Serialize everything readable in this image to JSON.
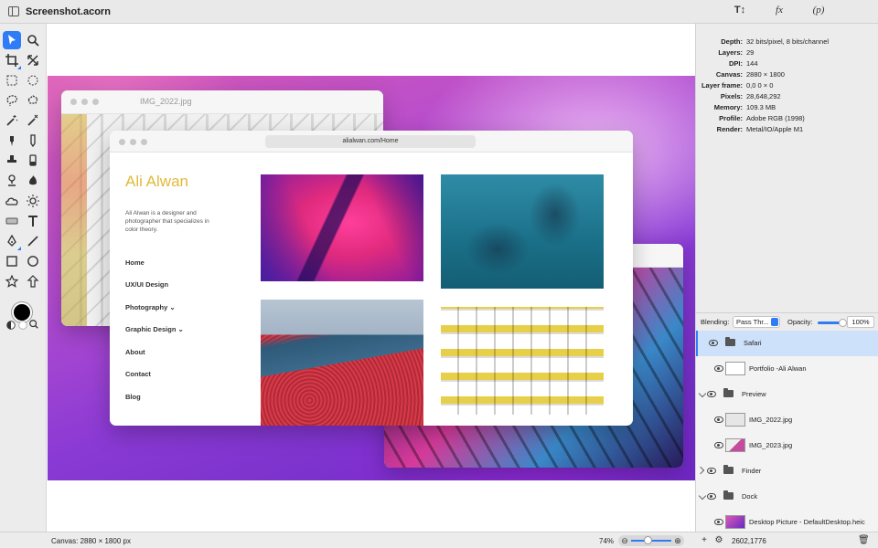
{
  "window": {
    "title": "Screenshot.acorn"
  },
  "titlebar_buttons": {
    "text_tool": "T↕",
    "fx": "fx",
    "p": "(p)"
  },
  "inspector": {
    "rows": [
      {
        "key": "Depth:",
        "value": "32 bits/pixel, 8 bits/channel"
      },
      {
        "key": "Layers:",
        "value": "29"
      },
      {
        "key": "DPI:",
        "value": "144"
      },
      {
        "key": "Canvas:",
        "value": "2880 × 1800"
      },
      {
        "key": "Layer frame:",
        "value": "0,0 0 × 0"
      },
      {
        "key": "Pixels:",
        "value": "28,648,292"
      },
      {
        "key": "Memory:",
        "value": "109.3 MB"
      },
      {
        "key": "Profile:",
        "value": "Adobe RGB (1998)"
      },
      {
        "key": "Render:",
        "value": "Metal/IO/Apple M1"
      }
    ]
  },
  "blending": {
    "label": "Blending:",
    "mode": "Pass Thr...",
    "opacity_label": "Opacity:",
    "opacity_value": "100%",
    "opacity_fraction": 1.0
  },
  "layers": [
    {
      "name": "Safari",
      "type": "group",
      "expanded": true,
      "selected": true
    },
    {
      "name": "Portfolio -Ali Alwan",
      "type": "image",
      "selected": false
    },
    {
      "name": "Preview",
      "type": "group",
      "expanded": true,
      "selected": false
    },
    {
      "name": "IMG_2022.jpg",
      "type": "image",
      "selected": false
    },
    {
      "name": "IMG_2023.jpg",
      "type": "image",
      "selected": false
    },
    {
      "name": "Finder",
      "type": "group",
      "expanded": false,
      "selected": false
    },
    {
      "name": "Dock",
      "type": "group",
      "expanded": true,
      "selected": false
    },
    {
      "name": "Desktop Picture - DefaultDesktop.heic",
      "type": "image",
      "selected": false
    }
  ],
  "canvas_content": {
    "preview1_filename": "IMG_2022.jpg",
    "safari_url": "alialwan.com/Home",
    "site": {
      "name": "Ali Alwan",
      "bio": "Ali Alwan is a designer and photographer that specializes in color theory.",
      "nav": [
        "Home",
        "UX/UI Design",
        "Photography ⌄",
        "Graphic Design ⌄",
        "About",
        "Contact",
        "Blog"
      ]
    }
  },
  "statusbar": {
    "canvas_size": "Canvas: 2880 × 1800 px",
    "zoom": "74%",
    "coords": "2602,1776"
  },
  "colors": {
    "accent": "#2e7cf6",
    "site_name": "#e2b93a",
    "selection": "#cde1fb"
  },
  "tools": [
    "select-arrow-icon",
    "zoom-icon",
    "crop-icon",
    "transform-icon",
    "rect-select-icon",
    "ellipse-select-icon",
    "lasso-icon",
    "polygon-lasso-icon",
    "magic-wand-icon",
    "magic-wand-alt-icon",
    "brush-icon",
    "pencil-icon",
    "stamp-icon",
    "eraser-icon",
    "dodge-icon",
    "burn-icon",
    "cloud-icon",
    "sun-icon",
    "rect-shape-icon",
    "text-icon",
    "pen-icon",
    "line-icon",
    "square-icon",
    "circle-icon",
    "star-icon",
    "arrow-icon"
  ]
}
